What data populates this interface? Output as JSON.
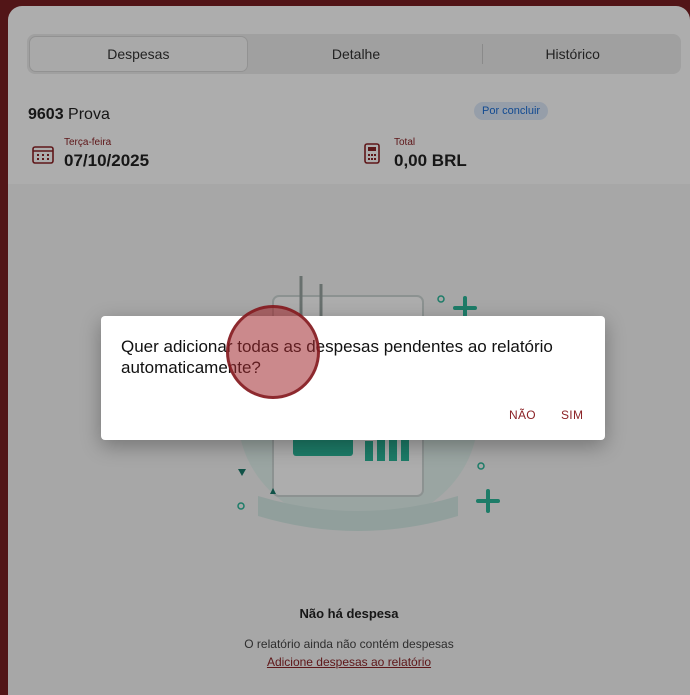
{
  "tabs": [
    {
      "label": "Despesas",
      "active": true
    },
    {
      "label": "Detalhe",
      "active": false
    },
    {
      "label": "Histórico",
      "active": false
    }
  ],
  "report": {
    "number": "9603",
    "name": "Prova",
    "status": "Por concluir",
    "date_label": "Terça-feira",
    "date_value": "07/10/2025",
    "total_label": "Total",
    "total_value": "0,00 BRL"
  },
  "empty_state": {
    "title": "Não há despesa",
    "subtitle": "O relatório ainda não contém despesas",
    "link": "Adicione despesas ao relatório"
  },
  "dialog": {
    "message": "Quer adicionar todas as despesas pendentes ao relatório automaticamente?",
    "no_label": "NÃO",
    "yes_label": "SIM"
  },
  "colors": {
    "brand": "#8b2226",
    "badge": "#1b6ed6",
    "illustration": "#2bb79a"
  },
  "icons": [
    "calendar-icon",
    "calculator-icon"
  ]
}
